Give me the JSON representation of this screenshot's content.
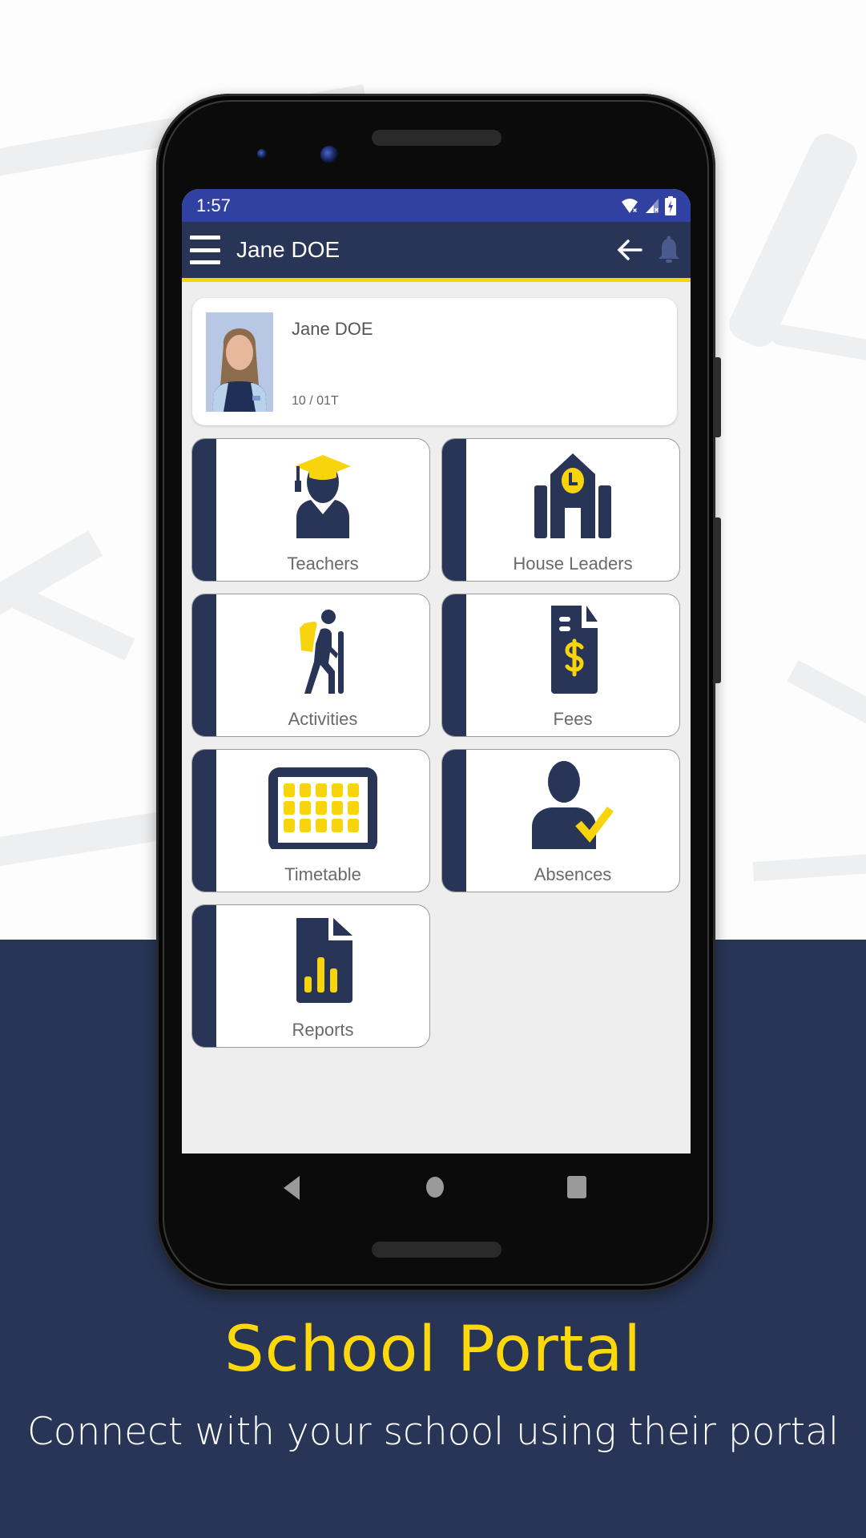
{
  "status_bar": {
    "time": "1:57",
    "icons": [
      "wifi-off-icon",
      "signal-off-icon",
      "battery-charging-icon"
    ]
  },
  "app_bar": {
    "title": "Jane DOE",
    "menu_icon": "hamburger-menu-icon",
    "back_icon": "arrow-left-icon",
    "notification_icon": "bell-icon"
  },
  "profile": {
    "name": "Jane DOE",
    "class": "10 / 01T",
    "photo": "student-photo"
  },
  "tiles": [
    {
      "label": "Teachers",
      "icon": "graduate-icon"
    },
    {
      "label": "House Leaders",
      "icon": "school-building-icon"
    },
    {
      "label": "Activities",
      "icon": "hiker-icon"
    },
    {
      "label": "Fees",
      "icon": "invoice-dollar-icon"
    },
    {
      "label": "Timetable",
      "icon": "calendar-grid-icon"
    },
    {
      "label": "Absences",
      "icon": "person-check-icon"
    },
    {
      "label": "Reports",
      "icon": "report-chart-icon"
    }
  ],
  "nav_bar": {
    "back": "nav-back-icon",
    "home": "nav-home-icon",
    "recents": "nav-recents-icon"
  },
  "promo": {
    "headline": "School Portal",
    "tagline": "Connect with your school using their portal"
  },
  "colors": {
    "navy": "#283556",
    "status_blue": "#3141a1",
    "accent_yellow": "#f8d40c",
    "screen_bg": "#eeeeee",
    "label_gray": "#6a6a6a"
  }
}
